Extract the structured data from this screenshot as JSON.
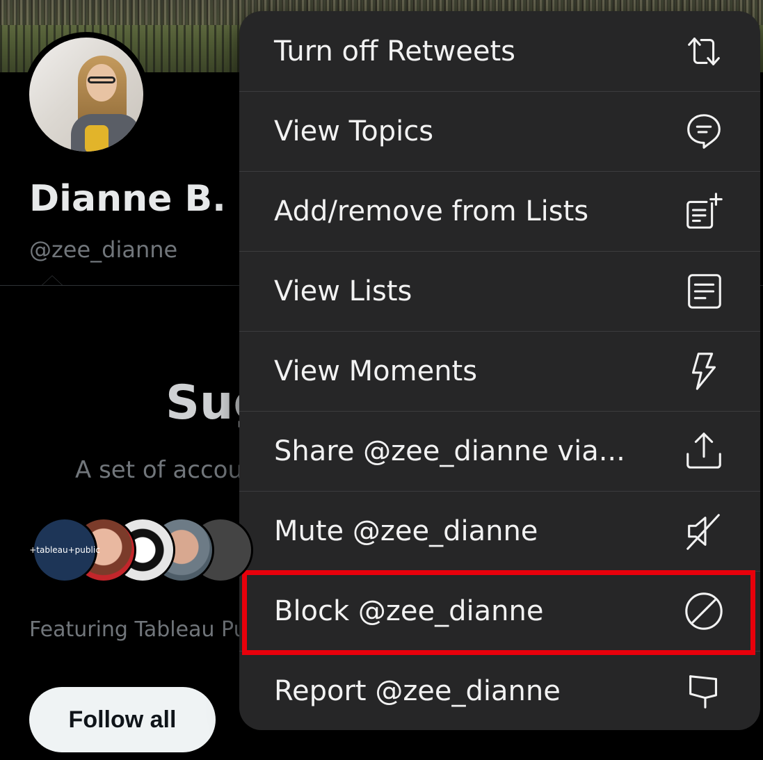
{
  "profile": {
    "name": "Dianne B. Z",
    "handle": "@zee_dianne"
  },
  "suggested": {
    "title": "Sug",
    "subtitle": "A set of accou",
    "avatar_first_text": "+tableau+public",
    "featuring": "Featuring Tableau Pu",
    "follow_all": "Follow all"
  },
  "menu": {
    "items": [
      {
        "label": "Turn off Retweets",
        "icon": "retweet-icon"
      },
      {
        "label": "View Topics",
        "icon": "topics-icon"
      },
      {
        "label": "Add/remove from Lists",
        "icon": "add-list-icon"
      },
      {
        "label": "View Lists",
        "icon": "lists-icon"
      },
      {
        "label": "View Moments",
        "icon": "lightning-icon"
      },
      {
        "label": "Share @zee_dianne via...",
        "icon": "share-icon"
      },
      {
        "label": "Mute @zee_dianne",
        "icon": "mute-icon"
      },
      {
        "label": "Block @zee_dianne",
        "icon": "block-icon"
      },
      {
        "label": "Report @zee_dianne",
        "icon": "flag-icon"
      }
    ]
  },
  "colors": {
    "background": "#000000",
    "menu_background": "#262627",
    "highlight": "#e8000b",
    "follow_button": "#eff3f4"
  }
}
